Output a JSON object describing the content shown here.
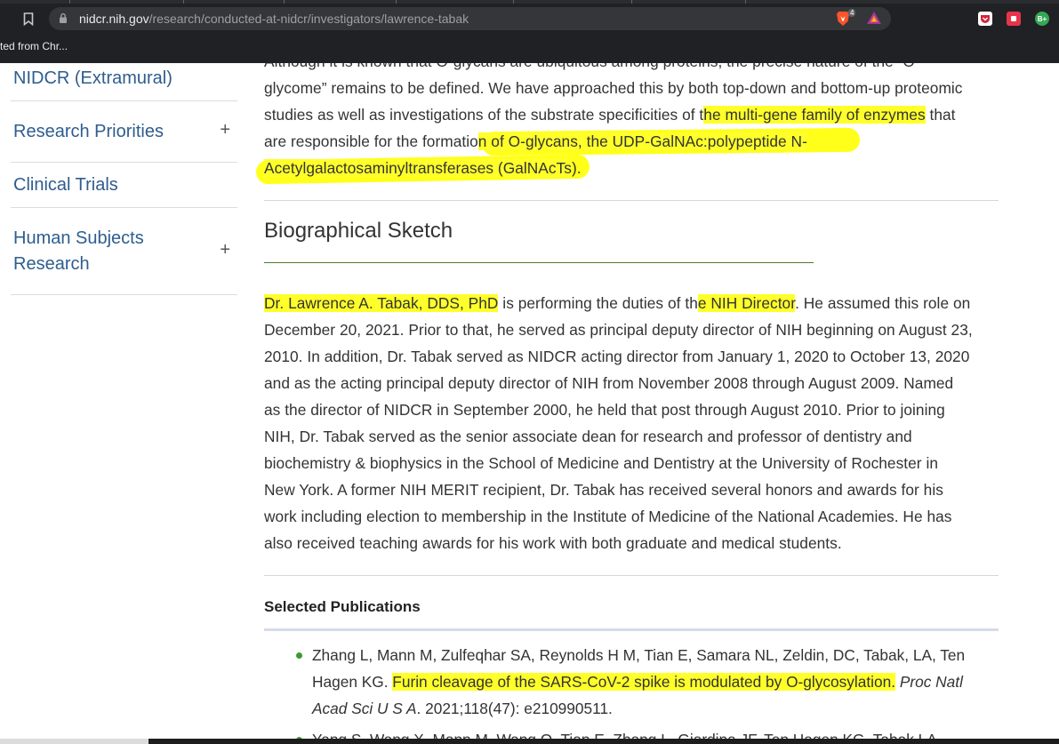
{
  "browser": {
    "url_host": "nidcr.nih.gov",
    "url_path": "/research/conducted-at-nidcr/investigators/lawrence-tabak",
    "brave_badge": "4",
    "bookmark_label": "ted from Chr...",
    "ext_b_label": "B+"
  },
  "sidebar": {
    "items": [
      {
        "label_line1": "NIDCR (Extramural)",
        "label_line2": "",
        "has_plus": false
      },
      {
        "label_line1": "Research Priorities",
        "label_line2": "",
        "has_plus": true
      },
      {
        "label_line1": "Clinical Trials",
        "label_line2": "",
        "has_plus": false
      },
      {
        "label_line1": "Human Subjects",
        "label_line2": "Research",
        "has_plus": true
      }
    ],
    "plus_symbol": "+"
  },
  "content": {
    "intro": {
      "line0": "Although it is known that O-glycans are ubiquitous among proteins, the precise nature of the “O-",
      "line1": "glycome” remains to be defined. We have approached this by both top-down and bottom-up proteomic",
      "line2_a": "studies as well as investigations of the substrate specificities of t",
      "line2_hl": "he multi-gene family of enzymes",
      "line2_b": " that",
      "line3_a": "are responsible for the formatio",
      "line3_hl": "n of O-glycans, the UDP-GalNAc:polypeptide N-",
      "line4_hl": "Acetylgalactosaminyltransferases (GalNAcTs",
      "line4_b": ")."
    },
    "bio_title": "Biographical Sketch",
    "bio": {
      "l1_hl1": "Dr. Lawrence A. Tabak, DDS, PhD",
      "l1_a": " is performing the duties of th",
      "l1_hl2": "e NIH Director",
      "l1_b": ". He assumed this role on",
      "l2": "December 20, 2021. Prior to that, he served as principal deputy director of NIH beginning on August 23,",
      "l3": "2010. In addition, Dr. Tabak served as NIDCR acting director from January 1, 2020 to October 13, 2020",
      "l4": "and as the acting principal deputy director of NIH from November 2008 through August 2009. Named",
      "l5": "as the director of NIDCR in September 2000, he held that post through August 2010. Prior to joining",
      "l6": "NIH, Dr. Tabak served as the senior associate dean for research and professor of dentistry and",
      "l7": "biochemistry & biophysics in the School of Medicine and Dentistry at the University of Rochester in",
      "l8": "New York. A former NIH MERIT recipient, Dr. Tabak has received several honors and awards for his",
      "l9": "work including election to membership in the Institute of Medicine of the National Academies. He has",
      "l10": "also received teaching awards for his work with both graduate and medical students."
    },
    "pub_title": "Selected Publications",
    "pub1": {
      "l1": "Zhang L, Mann M, Zulfeqhar SA, Reynolds H M, Tian E, Samara NL, Zeldin, DC, Tabak, LA, Ten",
      "l2_a": "Hagen KG. ",
      "l2_hl": "Furin cleavage of the SARS-CoV-2 spike is modulated by O-glycosylation.",
      "l2_it": " Proc Natl",
      "l3_it": "Acad Sci U S A",
      "l3_b": ". 2021;118(47): e210990511."
    },
    "pub2": {
      "l1": "Yang S, Wang X, Mann M, Wang Q, Tian E, Zhang L, Giardina JF, Ten Hagen KG, Tabak LA"
    }
  },
  "colors": {
    "highlight": "#ffff2a",
    "link": "#2e5d8e",
    "bullet": "#3a9b2f",
    "bio_rule": "#4a7c2a"
  }
}
